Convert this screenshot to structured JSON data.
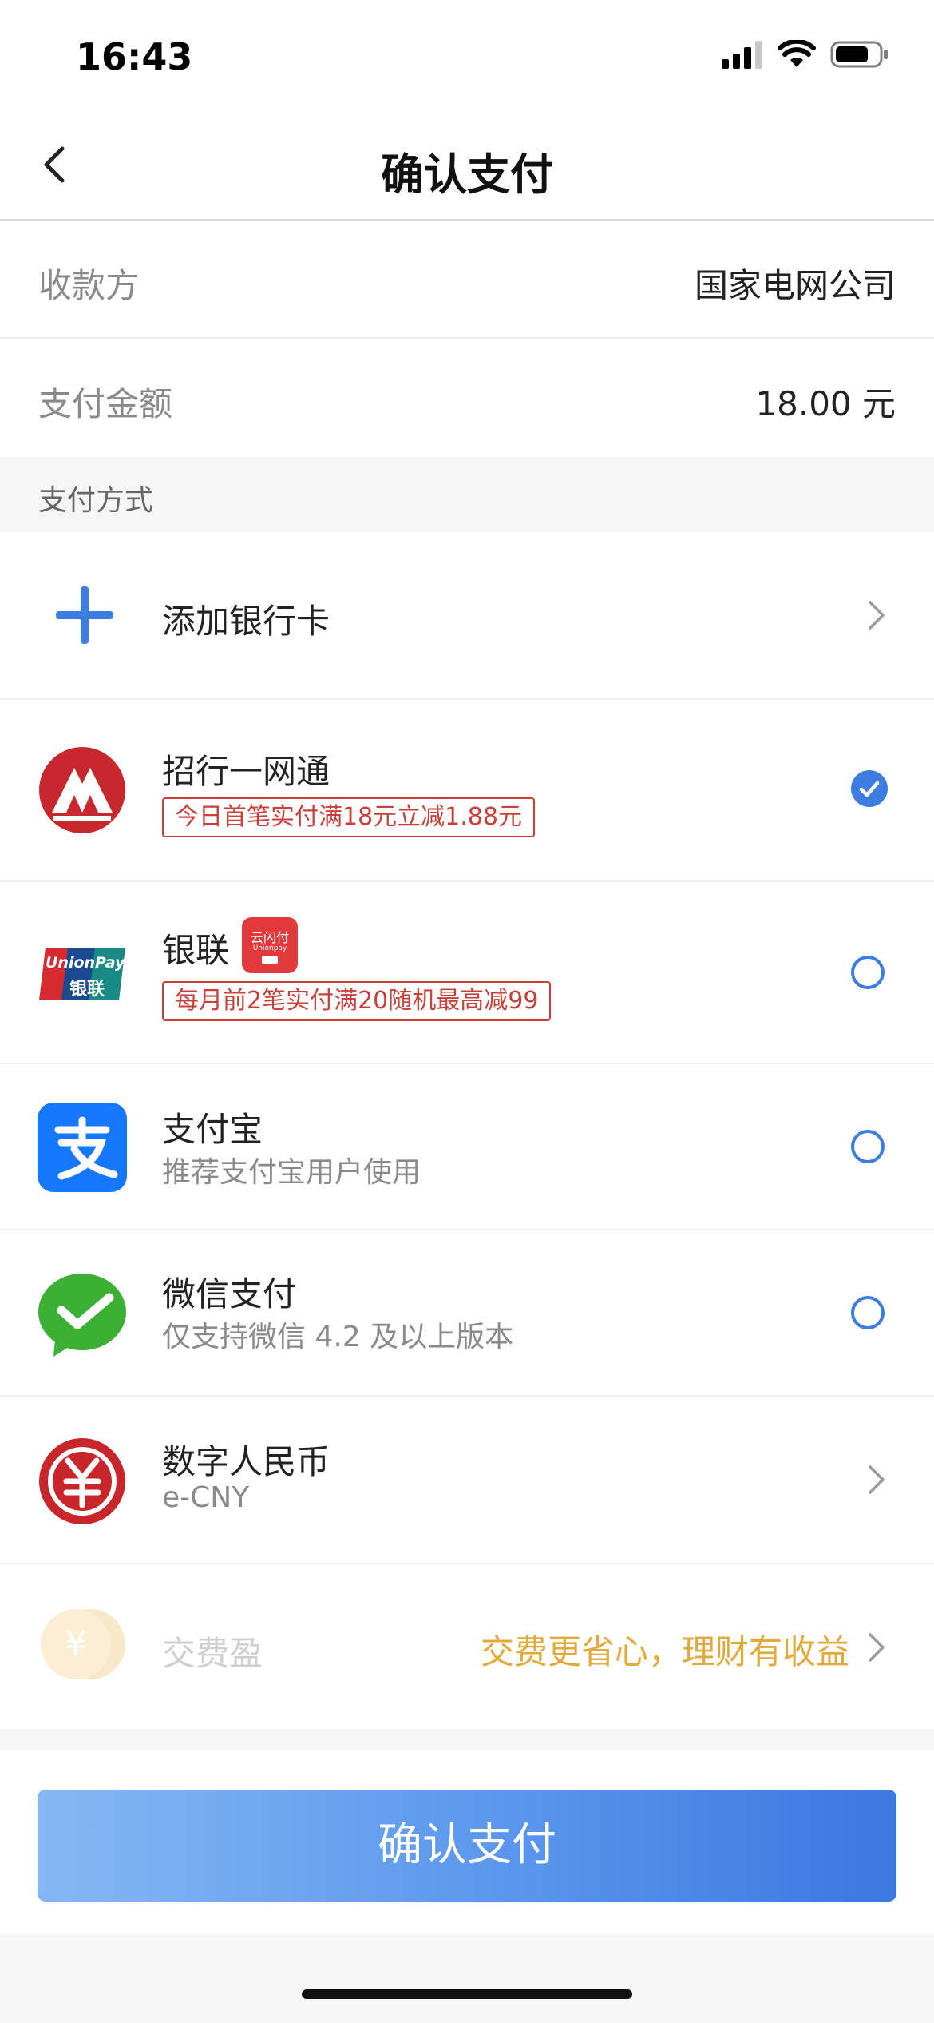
{
  "status": {
    "time": "16:43"
  },
  "nav": {
    "title": "确认支付"
  },
  "payee": {
    "label": "收款方",
    "value": "国家电网公司"
  },
  "amount": {
    "label": "支付金额",
    "value": "18.00 元"
  },
  "section": {
    "payment_methods": "支付方式"
  },
  "methods": {
    "add_card": {
      "title": "添加银行卡"
    },
    "cmb": {
      "title": "招行一网通",
      "promo": "今日首笔实付满18元立减1.88元",
      "selected": true
    },
    "unionpay": {
      "title": "银联",
      "promo": "每月前2笔实付满20随机最高减99",
      "logo_text": "UnionPay",
      "logo_cn": "银联",
      "badge_cn": "云闪付",
      "badge_en": "Unionpay"
    },
    "alipay": {
      "title": "支付宝",
      "subtitle": "推荐支付宝用户使用"
    },
    "wechat": {
      "title": "微信支付",
      "subtitle": "仅支持微信 4.2 及以上版本"
    },
    "ecny": {
      "title": "数字人民币",
      "subtitle": "e-CNY"
    },
    "jiaofeiying": {
      "title": "交费盈",
      "promo": "交费更省心，理财有收益"
    }
  },
  "confirm": {
    "label": "确认支付"
  },
  "colors": {
    "accent": "#3e7de0",
    "promo_red": "#c9403a",
    "gold": "#e2a93b"
  }
}
